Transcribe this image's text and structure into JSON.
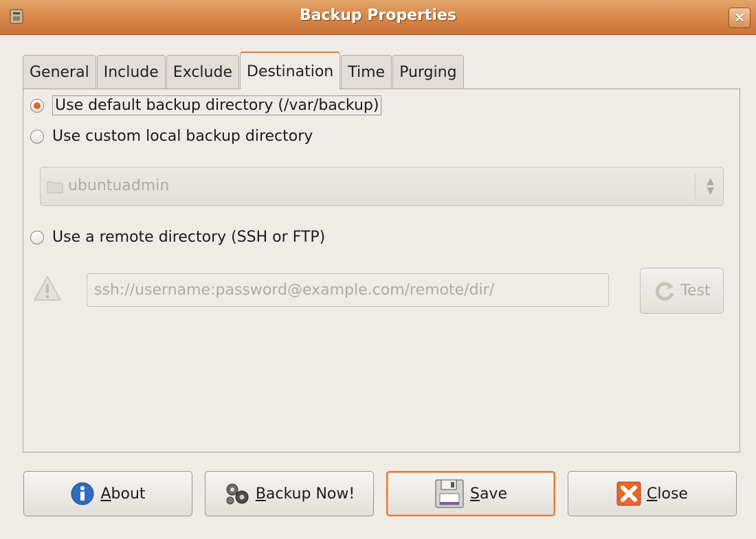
{
  "window": {
    "title": "Backup Properties",
    "close_glyph": "×"
  },
  "tabs": [
    {
      "label": "General",
      "active": false
    },
    {
      "label": "Include",
      "active": false
    },
    {
      "label": "Exclude",
      "active": false
    },
    {
      "label": "Destination",
      "active": true
    },
    {
      "label": "Time",
      "active": false
    },
    {
      "label": "Purging",
      "active": false
    }
  ],
  "destination": {
    "option_default": {
      "label": "Use default backup directory (/var/backup)",
      "checked": true
    },
    "option_custom": {
      "label": "Use custom local backup directory",
      "checked": false
    },
    "folder_combo": {
      "value": "ubuntuadmin",
      "icon": "folder-icon",
      "enabled": false
    },
    "option_remote": {
      "label": "Use a remote directory (SSH or FTP)",
      "checked": false
    },
    "remote_field": {
      "value": "ssh://username:password@example.com/remote/dir/",
      "enabled": false
    },
    "warning_icon": "warning-icon",
    "test_button": {
      "label": "Test",
      "icon": "refresh-icon",
      "enabled": false
    }
  },
  "buttons": {
    "about": {
      "mnemonic": "A",
      "rest": "bout",
      "icon": "info-icon"
    },
    "backup_now": {
      "mnemonic": "B",
      "rest": "ackup Now!",
      "icon": "gears-icon"
    },
    "save": {
      "mnemonic": "S",
      "rest": "ave",
      "icon": "floppy-icon",
      "default": true
    },
    "close": {
      "mnemonic": "C",
      "rest": "lose",
      "icon": "close-x-icon"
    }
  },
  "colors": {
    "titlebar": "#d98a4a",
    "accent": "#e07a34",
    "window_bg": "#efebe7",
    "info_blue": "#2f6bc2",
    "close_orange": "#e8672b"
  }
}
